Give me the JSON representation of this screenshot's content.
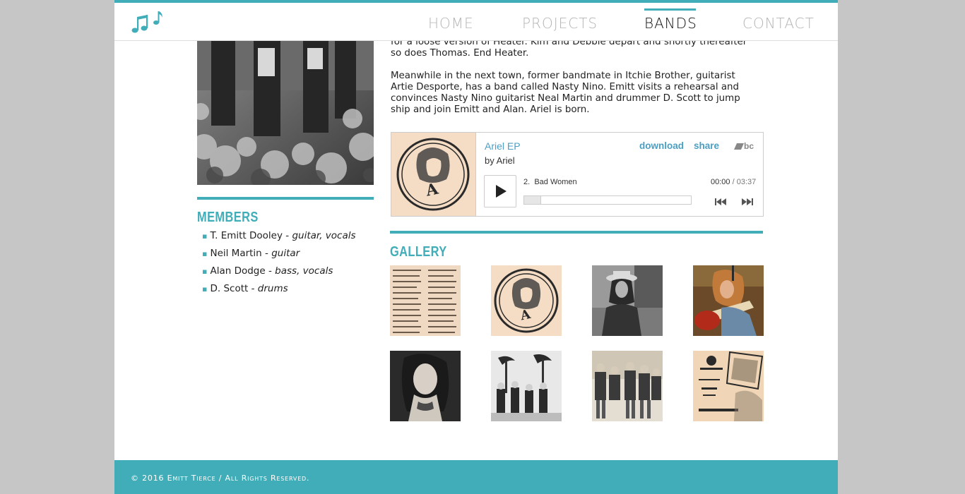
{
  "nav": {
    "items": [
      {
        "label": "HOME",
        "active": false
      },
      {
        "label": "PROJECTS",
        "active": false
      },
      {
        "label": "BANDS",
        "active": true
      },
      {
        "label": "CONTACT",
        "active": false
      }
    ]
  },
  "story": {
    "paragraphs": [
      "for a loose version of Heater. Kim and Debbie depart and shortly thereafter so does Thomas. End Heater.",
      "Meanwhile in the next town, former bandmate in Itchie Brother, guitarist Artie Desporte, has a band called Nasty Nino. Emitt visits a rehearsal and convinces Nasty Nino guitarist Neal Martin and drummer D. Scott to jump ship and join Emitt and Alan. Ariel is born."
    ]
  },
  "player": {
    "album": "Ariel EP",
    "by_prefix": "by",
    "artist": "Ariel",
    "download_label": "download",
    "share_label": "share",
    "brand_label": "bc",
    "track_number": "2.",
    "track_title": "Bad Women",
    "time_elapsed": "00:00",
    "time_separator": "/",
    "time_total": "03:37",
    "progress": 0
  },
  "members": {
    "title": "MEMBERS",
    "items": [
      {
        "name": "T. Emitt Dooley",
        "sep": " - ",
        "role": "guitar, vocals"
      },
      {
        "name": "Neil Martin",
        "sep": " - ",
        "role": "guitar"
      },
      {
        "name": "Alan Dodge",
        "sep": " - ",
        "role": "bass, vocals"
      },
      {
        "name": "D. Scott",
        "sep": " - ",
        "role": "drums"
      }
    ]
  },
  "gallery": {
    "title": "GALLERY",
    "items": [
      {
        "subject": "newspaper-clipping"
      },
      {
        "subject": "ariel-logo-cover"
      },
      {
        "subject": "musician-with-hat"
      },
      {
        "subject": "guitarist-live"
      },
      {
        "subject": "portrait-woman"
      },
      {
        "subject": "band-under-palm-trees"
      },
      {
        "subject": "band-sitting-outdoors"
      },
      {
        "subject": "pioneer-club-poster"
      }
    ]
  },
  "footer": {
    "text": "© 2016 Emitt Tierce / All Rights Reserved."
  },
  "colors": {
    "accent": "#40adb8",
    "link": "#4a9fc4",
    "page_bg": "#c6c6c6"
  }
}
